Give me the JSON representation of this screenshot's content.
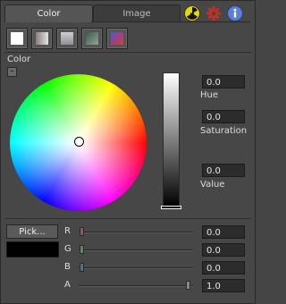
{
  "tabs": {
    "color_label": "Color",
    "image_label": "Image"
  },
  "section": {
    "color_label": "Color",
    "collapse": "–"
  },
  "hsv": {
    "hue": {
      "label": "Hue",
      "value": "0.0"
    },
    "saturation": {
      "label": "Saturation",
      "value": "0.0"
    },
    "value": {
      "label": "Value",
      "value": "0.0"
    }
  },
  "pick_label": "Pick...",
  "rgba": [
    {
      "label": "R",
      "value": "0.0"
    },
    {
      "label": "G",
      "value": "0.0"
    },
    {
      "label": "B",
      "value": "0.0"
    },
    {
      "label": "A",
      "value": "1.0"
    }
  ],
  "colors": {
    "background": "#474747",
    "current_color": "#000000",
    "field": "#2c2c2c"
  },
  "icons": [
    "radiation-icon",
    "gear-icon",
    "info-icon"
  ]
}
